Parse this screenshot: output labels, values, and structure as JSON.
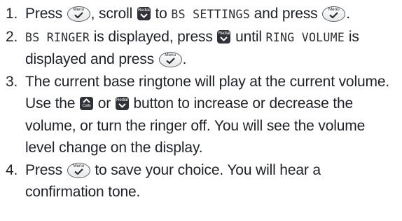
{
  "keys": {
    "menu_label": "Menu",
    "redial_label": "Redial",
    "calls_label": "Calls"
  },
  "icons": {
    "menu_confirm": "checkmark-icon",
    "redial_down": "chevron-down-icon",
    "calls_up": "chevron-up-icon"
  },
  "steps": [
    {
      "number": "1.",
      "t1": "Press",
      "t2": ", scroll",
      "t3": "to",
      "lcd1": "BS SETTINGS",
      "t4": "and press",
      "t5": "."
    },
    {
      "number": "2.",
      "lcd1": "BS RINGER",
      "t1": "is displayed, press",
      "t2": "until",
      "lcd2": "RING VOLUME",
      "t3": "is displayed and press",
      "t4": "."
    },
    {
      "number": "3.",
      "t1": "The current base ringtone will play at the current volume. Use the",
      "t2": "or",
      "t3": "button to increase or decrease the volume, or turn the ringer off. You will see the volume level change on the display."
    },
    {
      "number": "4.",
      "t1": "Press",
      "t2": "to save your choice. You will hear a confirmation tone."
    }
  ]
}
